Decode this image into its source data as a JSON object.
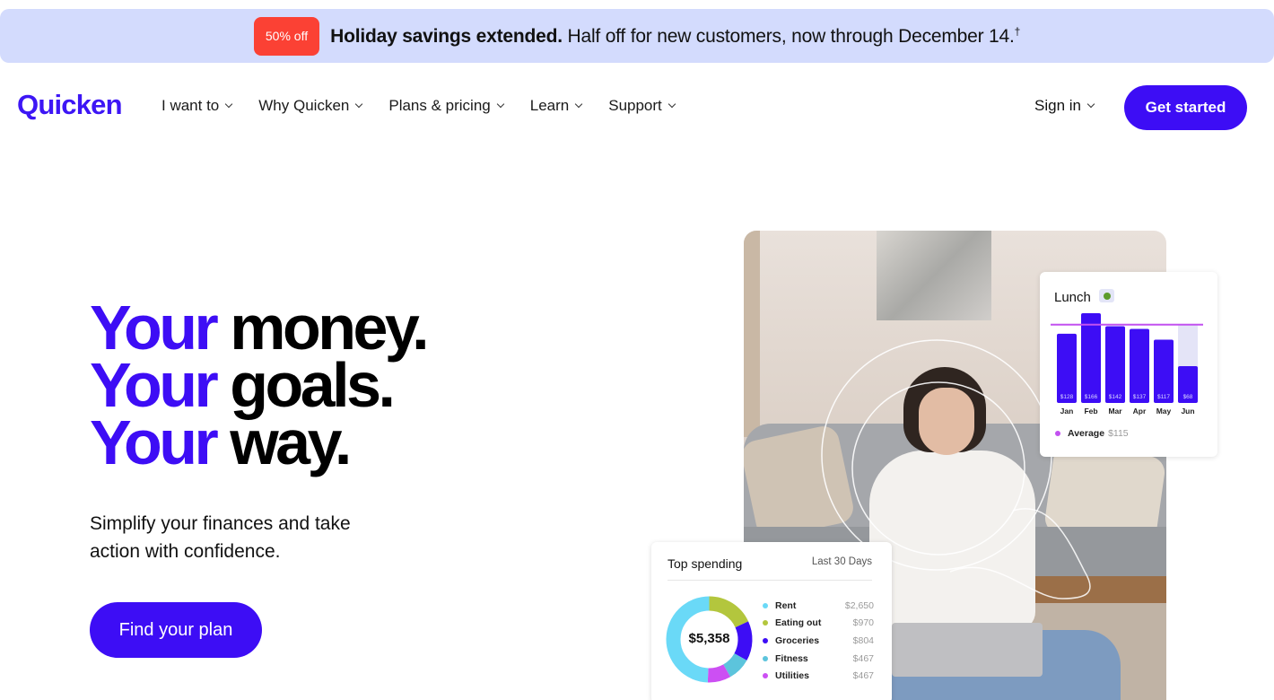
{
  "promo": {
    "badge": "50% off",
    "headline_bold": "Holiday savings extended.",
    "headline_rest": " Half off for new customers, now through December 14.",
    "footnote_mark": "†"
  },
  "nav": {
    "logo": "Quicken",
    "items": [
      {
        "label": "I want to"
      },
      {
        "label": "Why Quicken"
      },
      {
        "label": "Plans & pricing"
      },
      {
        "label": "Learn"
      },
      {
        "label": "Support"
      }
    ],
    "sign_in": "Sign in",
    "get_started": "Get started"
  },
  "hero": {
    "lines": [
      {
        "accent": "Your",
        "rest": "money."
      },
      {
        "accent": "Your",
        "rest": "goals."
      },
      {
        "accent": "Your",
        "rest": "way."
      }
    ],
    "subhead": "Simplify your finances and take action with confidence.",
    "cta": "Find your plan"
  },
  "colors": {
    "brand": "#3d0df5",
    "promo_bg": "#d3dbfd",
    "promo_badge": "#fb4134",
    "average_line": "#c251f0"
  },
  "lunch_card": {
    "title": "Lunch",
    "icon": "salad-icon",
    "legend_label": "Average",
    "legend_value": "$115"
  },
  "spending_card": {
    "title": "Top spending",
    "range": "Last 30 Days",
    "total": "$5,358"
  },
  "chart_data": [
    {
      "type": "bar",
      "title": "Lunch",
      "categories": [
        "Jan",
        "Feb",
        "Mar",
        "Apr",
        "May",
        "Jun"
      ],
      "values": [
        128,
        166,
        142,
        137,
        117,
        68
      ],
      "value_labels": [
        "$128",
        "$166",
        "$142",
        "$137",
        "$117",
        "$68"
      ],
      "average": 115,
      "average_label": "Average $115",
      "ylim": [
        0,
        166
      ],
      "partial_last_target": 115,
      "bar_color": "#3d0df5",
      "ghost_color": "#e4e4f7",
      "grid": false
    },
    {
      "type": "pie",
      "title": "Top spending",
      "subtitle": "Last 30 Days",
      "center_label": "$5,358",
      "slices": [
        {
          "label": "Rent",
          "value": 2650,
          "display": "$2,650",
          "color": "#6ad9f7"
        },
        {
          "label": "Eating out",
          "value": 970,
          "display": "$970",
          "color": "#b3c63d"
        },
        {
          "label": "Groceries",
          "value": 804,
          "display": "$804",
          "color": "#3d0df5"
        },
        {
          "label": "Fitness",
          "value": 467,
          "display": "$467",
          "color": "#5cc4dc"
        },
        {
          "label": "Utilities",
          "value": 467,
          "display": "$467",
          "color": "#cc4ff3"
        }
      ]
    }
  ]
}
